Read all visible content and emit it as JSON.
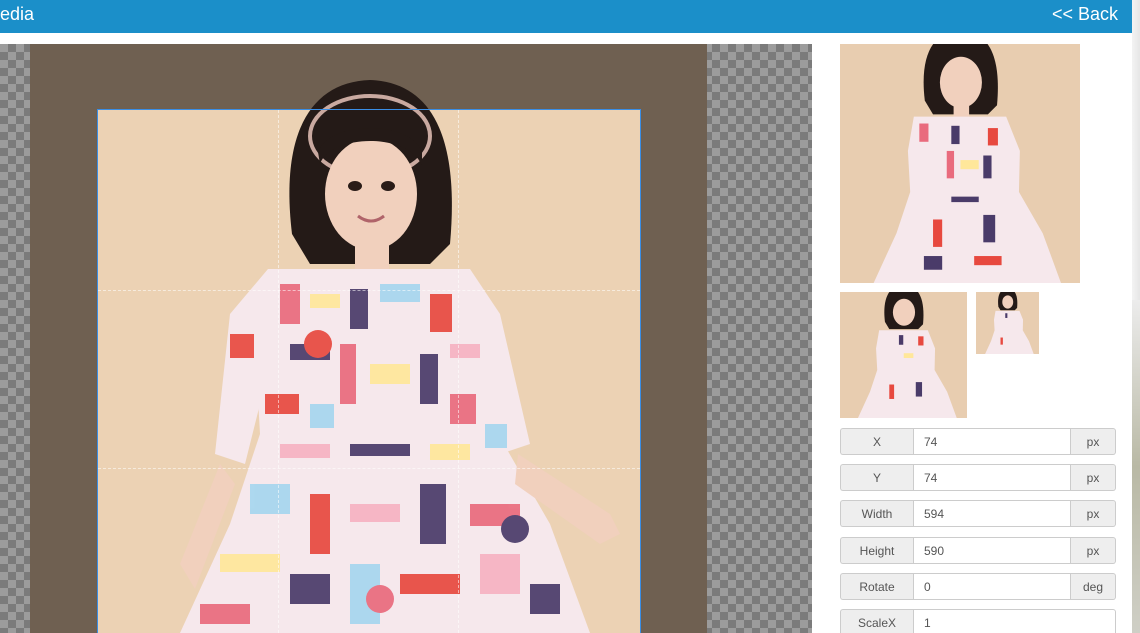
{
  "header": {
    "title": "edia",
    "back_label": "<< Back"
  },
  "colors": {
    "header_bg": "#1b8fc9",
    "crop_outline": "#3a8ee6",
    "photo_backdrop": "#6f6051",
    "skin_background": "#ecd2b4"
  },
  "fields": [
    {
      "label": "X",
      "value": "74",
      "unit": "px"
    },
    {
      "label": "Y",
      "value": "74",
      "unit": "px"
    },
    {
      "label": "Width",
      "value": "594",
      "unit": "px"
    },
    {
      "label": "Height",
      "value": "590",
      "unit": "px"
    },
    {
      "label": "Rotate",
      "value": "0",
      "unit": "deg"
    },
    {
      "label": "ScaleX",
      "value": "1",
      "unit": ""
    }
  ]
}
